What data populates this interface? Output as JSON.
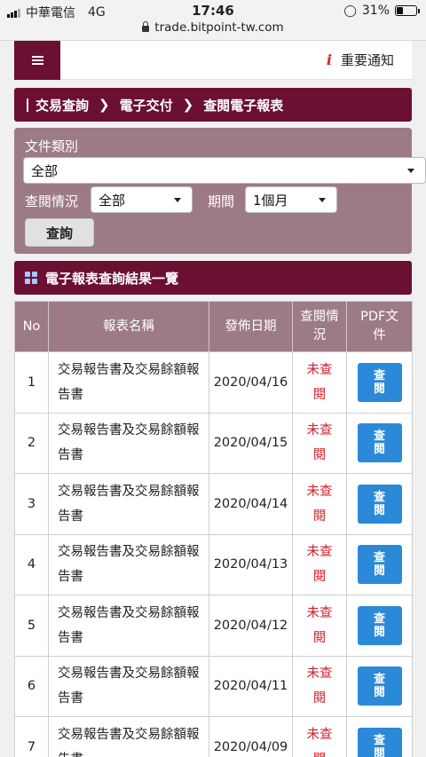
{
  "status_bar": {
    "carrier": "中華電信",
    "network": "4G",
    "time": "17:46",
    "battery": "31%"
  },
  "url_bar": {
    "url": "trade.bitpoint-tw.com"
  },
  "header": {
    "notice_label": "重要通知"
  },
  "breadcrumb": {
    "items": [
      "交易查詢",
      "電子交付",
      "查閱電子報表"
    ]
  },
  "search": {
    "doc_type_label": "文件類別",
    "doc_type_value": "全部",
    "view_status_label": "查閱情況",
    "view_status_value": "全部",
    "period_label": "期間",
    "period_value": "1個月",
    "search_button": "查詢"
  },
  "results": {
    "title": "電子報表查詢結果一覽",
    "columns": [
      "No",
      "報表名稱",
      "發佈日期",
      "查閱情況",
      "PDF文件"
    ],
    "rows": [
      {
        "no": "1",
        "name": "交易報告書及交易餘額報告書",
        "date": "2020/04/16",
        "status": "未查閱",
        "button": "查閱"
      },
      {
        "no": "2",
        "name": "交易報告書及交易餘額報告書",
        "date": "2020/04/15",
        "status": "未查閱",
        "button": "查閱"
      },
      {
        "no": "3",
        "name": "交易報告書及交易餘額報告書",
        "date": "2020/04/14",
        "status": "未查閱",
        "button": "查閱"
      },
      {
        "no": "4",
        "name": "交易報告書及交易餘額報告書",
        "date": "2020/04/13",
        "status": "未查閱",
        "button": "查閱"
      },
      {
        "no": "5",
        "name": "交易報告書及交易餘額報告書",
        "date": "2020/04/12",
        "status": "未查閱",
        "button": "查閱"
      },
      {
        "no": "6",
        "name": "交易報告書及交易餘額報告書",
        "date": "2020/04/11",
        "status": "未查閱",
        "button": "查閱"
      },
      {
        "no": "7",
        "name": "交易報告書及交易餘額報告書",
        "date": "2020/04/09",
        "status": "未查閱",
        "button": "查閱"
      }
    ]
  },
  "colors": {
    "brand": "#6b0f33",
    "panel": "#9c7a88",
    "button_blue": "#2b8ad8",
    "unread_red": "#d0202a"
  },
  "icons": [
    "signal-icon",
    "lock-icon",
    "battery-icon",
    "hamburger-icon",
    "info-icon",
    "grid-icon"
  ]
}
